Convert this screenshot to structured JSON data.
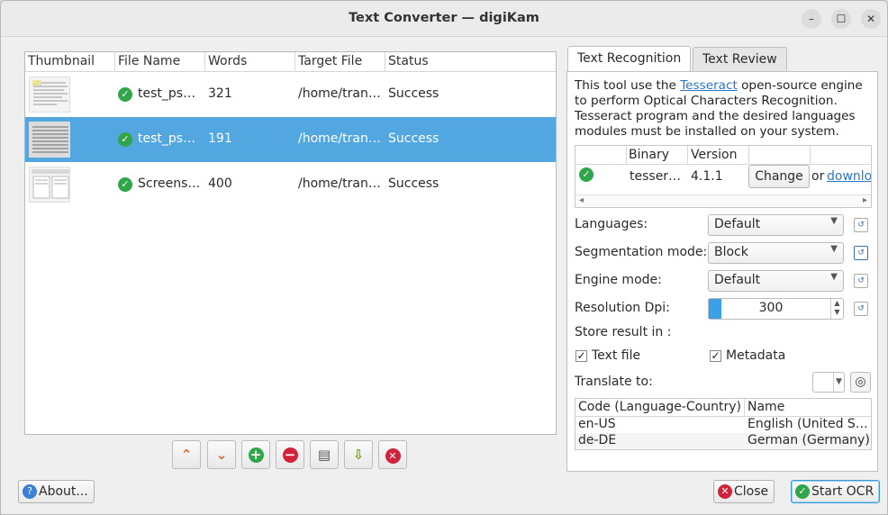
{
  "window": {
    "title": "Text Converter — digiKam",
    "min": "–",
    "max": "☐",
    "close": "✕"
  },
  "filelist": {
    "headers": [
      "Thumbnail",
      "File Name",
      "Words",
      "Target File",
      "Status"
    ],
    "rows": [
      {
        "file": "test_ps…",
        "words": "321",
        "target": "/home/tran…",
        "status": "Success",
        "selected": false
      },
      {
        "file": "test_ps…",
        "words": "191",
        "target": "/home/tran…",
        "status": "Success",
        "selected": true
      },
      {
        "file": "Screens…",
        "words": "400",
        "target": "/home/tran…",
        "status": "Success",
        "selected": false
      }
    ]
  },
  "toolbar": {
    "up": "⌃",
    "down": "⌄",
    "add": "+",
    "remove": "−",
    "load": "▤",
    "export": "⇩",
    "clear": "✕"
  },
  "tabs": [
    "Text Recognition",
    "Text Review"
  ],
  "intro": {
    "before": "This tool use the ",
    "link": "Tesseract",
    "after": " open-source engine to perform Optical Characters Recognition. Tesseract program and the desired languages modules must be installed on your system."
  },
  "binaries": {
    "headers": [
      "Binary",
      "Version"
    ],
    "row": {
      "binary": "tesser…",
      "version": "4.1.1",
      "change": "Change",
      "or": "or",
      "download": "downlo"
    }
  },
  "settings": {
    "languages": {
      "label": "Languages:",
      "value": "Default"
    },
    "segmentation": {
      "label": "Segmentation mode:",
      "value": "Block"
    },
    "engine": {
      "label": "Engine mode:",
      "value": "Default"
    },
    "dpi": {
      "label": "Resolution Dpi:",
      "value": "300"
    },
    "store_label": "Store result in :",
    "text_file": {
      "label": "Text file",
      "checked": true
    },
    "metadata": {
      "label": "Metadata",
      "checked": true
    },
    "translate_label": "Translate to:"
  },
  "languages_table": {
    "headers": [
      "Code (Language-Country)",
      "Name"
    ],
    "rows": [
      {
        "code": "en-US",
        "name": "English (United S…"
      },
      {
        "code": "de-DE",
        "name": "German (Germany)"
      }
    ]
  },
  "buttons": {
    "about": "About...",
    "close": "Close",
    "start": "Start OCR"
  },
  "colors": {
    "accent": "#53a7e0",
    "success": "#2fa64a",
    "danger": "#d0243c",
    "link": "#2a77c9"
  }
}
